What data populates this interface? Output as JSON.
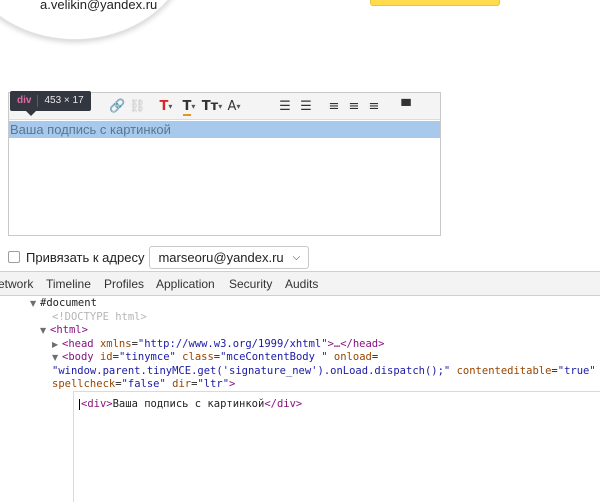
{
  "account": {
    "email": "a.velikin@yandex.ru"
  },
  "tooltip": {
    "tag": "div",
    "dims": "453 × 17"
  },
  "toolbar": {
    "icons": [
      {
        "name": "link-icon",
        "glyph": "🔗",
        "disabled": true
      },
      {
        "name": "unlink-icon",
        "glyph": "⛓",
        "disabled": true
      },
      {
        "name": "text-color-icon",
        "glyph": "T"
      },
      {
        "name": "text-background-icon",
        "glyph": "T"
      },
      {
        "name": "font-size-icon",
        "glyph": "Tт"
      },
      {
        "name": "font-family-icon",
        "glyph": "A"
      },
      {
        "name": "bullet-list-icon",
        "glyph": "☰"
      },
      {
        "name": "numbered-list-icon",
        "glyph": "☰"
      },
      {
        "name": "align-left-icon",
        "glyph": "≡"
      },
      {
        "name": "align-center-icon",
        "glyph": "≡"
      },
      {
        "name": "align-right-icon",
        "glyph": "≡"
      },
      {
        "name": "format-painter-icon",
        "glyph": "▀"
      }
    ]
  },
  "editor": {
    "content": "Ваша подпись с картинкой"
  },
  "bind": {
    "label": "Привязать к адресу",
    "selected_address": "marseoru@yandex.ru"
  },
  "devtools": {
    "tabs": [
      "etwork",
      "Timeline",
      "Profiles",
      "Application",
      "Security",
      "Audits"
    ],
    "tree": {
      "document": "#document",
      "doctype": "<!DOCTYPE html>",
      "html_tag": "html",
      "head": {
        "tag": "head",
        "attr_name": "xmlns",
        "attr_value": "\"http://www.w3.org/1999/xhtml\"",
        "ellipsis": "…</head>"
      },
      "body": {
        "tag": "body",
        "id_name": "id",
        "id_value": "\"tinymce\"",
        "class_name": "class",
        "class_value": "\"mceContentBody \"",
        "onload_name": "onload",
        "onload_value": "\"window.parent.tinyMCE.get('signature_new').onLoad.dispatch();\"",
        "ce_name": "contenteditable",
        "ce_value": "\"true\"",
        "sc_name": "spellcheck",
        "sc_value": "\"false\"",
        "dir_name": "dir",
        "dir_value": "\"ltr\""
      }
    },
    "source": {
      "open": "<div>",
      "text": "Ваша подпись с картинкой",
      "close": "</div>"
    }
  },
  "colors": {
    "selection": "#a9c9ec",
    "tooltip_bg": "#333740",
    "tag": "#881280",
    "attr_name": "#994500",
    "attr_value": "#1a1aa6",
    "yellow": "#ffdb4d"
  }
}
